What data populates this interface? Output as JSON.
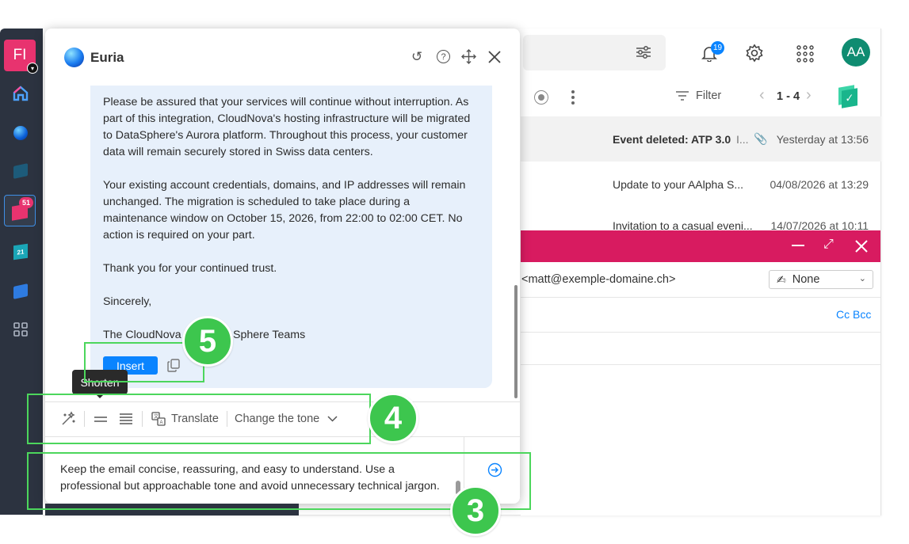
{
  "rail": {
    "profile_initials": "FI",
    "mail_badge": "51",
    "calendar_day": "21"
  },
  "mail": {
    "notif_count": "19",
    "avatar_initials": "AA",
    "filter_label": "Filter",
    "pagination": "1 - 4",
    "rows": [
      {
        "subject": "Event deleted: ATP 3.0",
        "ellipsis": "I...",
        "date": "Yesterday at 13:56"
      },
      {
        "subject": "Update to your AAlpha S...",
        "date": "04/08/2026 at 13:29"
      },
      {
        "subject": "Invitation to a casual eveni...",
        "date": "14/07/2026 at 10:11"
      }
    ],
    "compose": {
      "from_address": "<matt@exemple-domaine.ch>",
      "signature_value": "None",
      "cc_bcc": "Cc Bcc"
    }
  },
  "euria": {
    "title": "Euria",
    "paragraphs": [
      [
        "Please be assured that your services will continue without interruption. As",
        "part of this integration, CloudNova's hosting infrastructure will be migrated",
        "to DataSphere's Aurora platform. Throughout this process, your customer",
        "data will remain securely stored in Swiss data centers."
      ],
      [
        "Your existing account credentials, domains, and IP addresses will remain",
        "unchanged. The migration is scheduled to take place during a",
        "maintenance window on October 15, 2026, from 22:00 to 02:00 CET. No",
        "action is required on your part."
      ],
      [
        "Thank you for your continued trust."
      ],
      [
        "Sincerely,"
      ],
      [
        "The CloudNova",
        "Sphere Teams"
      ]
    ],
    "insert_label": "Insert",
    "tooltip": "Shorten",
    "toolbar": {
      "translate": "Translate",
      "change_tone": "Change the tone"
    },
    "prompt_lines": [
      "Keep the email concise, reassuring, and easy to understand. Use a",
      "professional but approachable tone and avoid unnecessary technical jargon."
    ]
  },
  "callouts": {
    "badge_3": "3",
    "badge_4": "4",
    "badge_5": "5"
  },
  "colors": {
    "accent": "#0a84ff",
    "compose_bar": "#d81b60",
    "callout": "#3dc64e",
    "bubble": "#e7f0fb"
  }
}
